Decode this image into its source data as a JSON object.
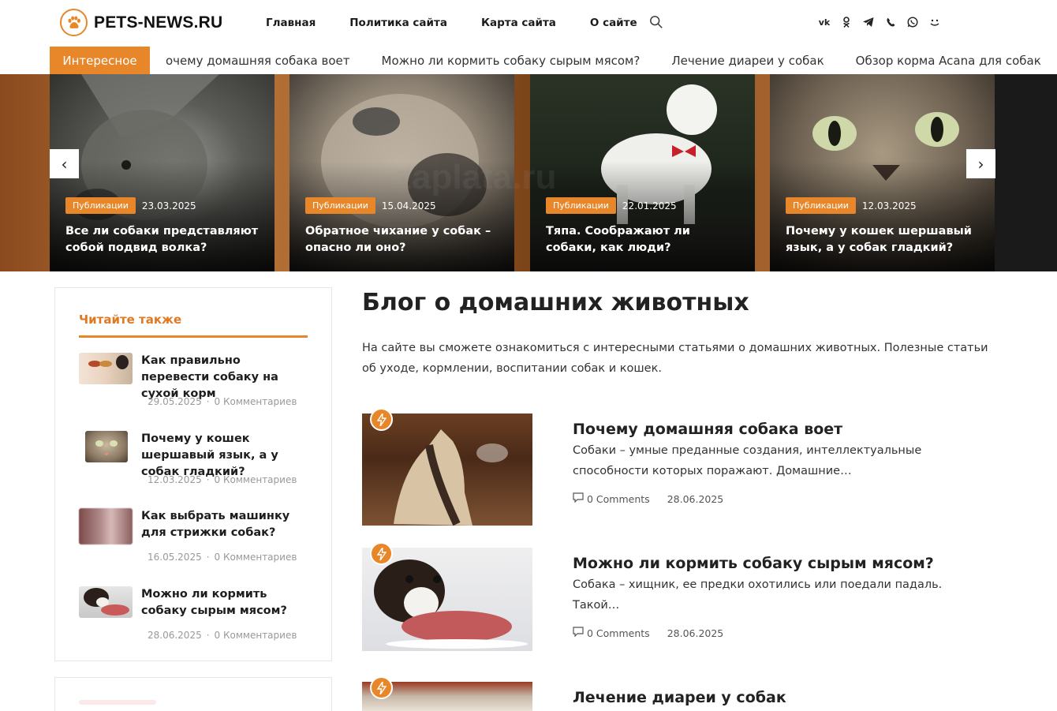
{
  "header": {
    "logo_text": "PETS-NEWS.RU",
    "nav": [
      "Главная",
      "Политика сайта",
      "Карта сайта",
      "О сайте"
    ],
    "social": [
      "vk-icon",
      "ok-icon",
      "telegram-icon",
      "viber-icon",
      "whatsapp-icon",
      "rss-icon"
    ]
  },
  "ticker": {
    "label": "Интересное",
    "items": [
      "очему домашняя собака воет",
      "Можно ли кормить собаку сырым мясом?",
      "Лечение диареи у собак",
      "Обзор корма Acana для собак"
    ]
  },
  "slider": {
    "prev": "‹",
    "next": "›",
    "slides": [
      {
        "badge": "Публикации",
        "date": "23.03.2025",
        "title": "Все ли собаки представляют собой подвид волка?"
      },
      {
        "badge": "Публикации",
        "date": "15.04.2025",
        "title": "Обратное чихание у собак – опасно ли оно?"
      },
      {
        "badge": "Публикации",
        "date": "22.01.2025",
        "title": "Тяпа. Соображают ли собаки, как люди?"
      },
      {
        "badge": "Публикации",
        "date": "12.03.2025",
        "title": "Почему у кошек шершавый язык, а у собак гладкий?"
      }
    ]
  },
  "sidebar": {
    "title": "Читайте также",
    "items": [
      {
        "title": "Как правильно перевести собаку на сухой корм",
        "date": "29.05.2025",
        "comments": "0 Комментариев"
      },
      {
        "title": "Почему у кошек шершавый язык, а у собак гладкий?",
        "date": "12.03.2025",
        "comments": "0 Комментариев"
      },
      {
        "title": "Как выбрать машинку для стрижки собак?",
        "date": "16.05.2025",
        "comments": "0 Комментариев"
      },
      {
        "title": "Можно ли кормить собаку сырым мясом?",
        "date": "28.06.2025",
        "comments": "0 Комментариев"
      }
    ]
  },
  "main": {
    "title": "Блог о домашних животных",
    "description": "На сайте вы сможете ознакомиться с интересными статьями о домашних животных. Полезные статьи об уходе, кормлении, воспитании собак и кошек.",
    "posts": [
      {
        "title": "Почему домашняя собака воет",
        "excerpt": "Собаки – умные преданные создания, интеллектуальные способности которых поражают. Домашние…",
        "comments": "0 Comments",
        "date": "28.06.2025"
      },
      {
        "title": "Можно ли кормить собаку сырым мясом?",
        "excerpt": "Собака – хищник, ее предки охотились или поедали падаль. Такой…",
        "comments": "0 Comments",
        "date": "28.06.2025"
      },
      {
        "title": "Лечение диареи у собак",
        "excerpt": "",
        "comments": "",
        "date": ""
      }
    ]
  },
  "watermark": "zaplata.ru",
  "colors": {
    "accent": "#e8862a"
  }
}
